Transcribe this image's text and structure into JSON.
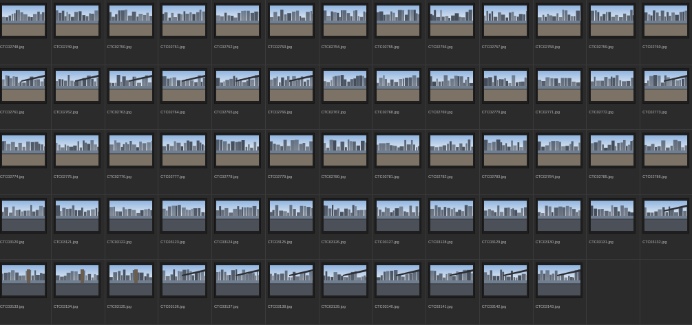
{
  "thumbnail_icon": "photo-thumbnail",
  "files": [
    "CTC02748.jpg",
    "CTC02749.jpg",
    "CTC02750.jpg",
    "CTC02751.jpg",
    "CTC02752.jpg",
    "CTC02753.jpg",
    "CTC02754.jpg",
    "CTC02755.jpg",
    "CTC02756.jpg",
    "CTC02757.jpg",
    "CTC02758.jpg",
    "CTC02759.jpg",
    "CTC02760.jpg",
    "CTC02761.jpg",
    "CTC02762.jpg",
    "CTC02763.jpg",
    "CTC02764.jpg",
    "CTC02765.jpg",
    "CTC02766.jpg",
    "CTC02767.jpg",
    "CTC02768.jpg",
    "CTC02769.jpg",
    "CTC02770.jpg",
    "CTC02771.jpg",
    "CTC02772.jpg",
    "CTC02773.jpg",
    "CTC02774.jpg",
    "CTC02775.jpg",
    "CTC02776.jpg",
    "CTC02777.jpg",
    "CTC02778.jpg",
    "CTC02779.jpg",
    "CTC02780.jpg",
    "CTC02781.jpg",
    "CTC02782.jpg",
    "CTC02783.jpg",
    "CTC02784.jpg",
    "CTC02785.jpg",
    "CTC02786.jpg",
    "CTC03120.jpg",
    "CTC03121.jpg",
    "CTC03122.jpg",
    "CTC03123.jpg",
    "CTC03124.jpg",
    "CTC03125.jpg",
    "CTC03126.jpg",
    "CTC03127.jpg",
    "CTC03128.jpg",
    "CTC03129.jpg",
    "CTC03130.jpg",
    "CTC03131.jpg",
    "CTC03132.jpg",
    "CTC03133.jpg",
    "CTC03134.jpg",
    "CTC03135.jpg",
    "CTC03136.jpg",
    "CTC03137.jpg",
    "CTC03138.jpg",
    "CTC03139.jpg",
    "CTC03140.jpg",
    "CTC03141.jpg",
    "CTC03142.jpg",
    "CTC03143.jpg"
  ],
  "colors": {
    "background": "#262626",
    "cell": "#2b2b2b",
    "label": "#b8b8b8",
    "sky_top": "#8fb4e0",
    "sky_bottom": "#e6ecf3",
    "water": "#6f7f91",
    "ground": "#7d7266",
    "skyline": "#3b4350"
  }
}
